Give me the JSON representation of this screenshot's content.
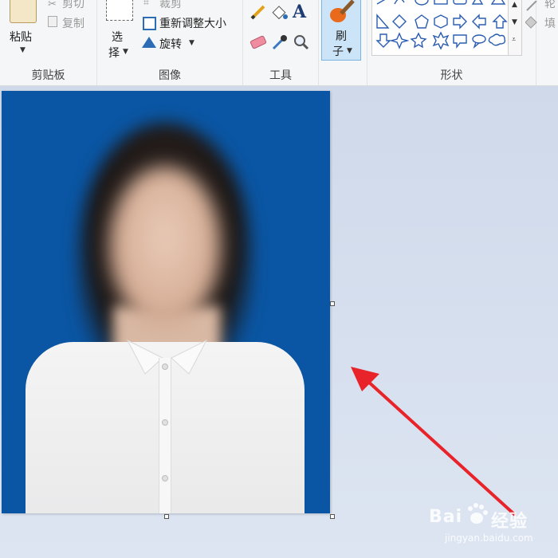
{
  "ribbon": {
    "clipboard": {
      "paste_label": "粘贴",
      "cut_label": "剪切",
      "copy_label": "复制",
      "group_label": "剪贴板"
    },
    "image": {
      "select_label_top": "选",
      "select_label_bottom": "择",
      "crop_label": "裁剪",
      "resize_label": "重新调整大小",
      "rotate_label": "旋转",
      "group_label": "图像"
    },
    "tools": {
      "group_label": "工具",
      "text_tool_glyph": "A"
    },
    "brush": {
      "label_top": "刷",
      "label_bottom": "子"
    },
    "shapes": {
      "group_label": "形状"
    },
    "right_partial": {
      "outline_label": "轮",
      "fill_label": "填"
    }
  },
  "watermark": {
    "brand": "Bai",
    "brand_cn": "经验",
    "url": "jingyan.baidu.com"
  },
  "colors": {
    "canvas_bg": "#0a56a4",
    "arrow": "#e8232a",
    "workspace": "#d6dff0"
  }
}
